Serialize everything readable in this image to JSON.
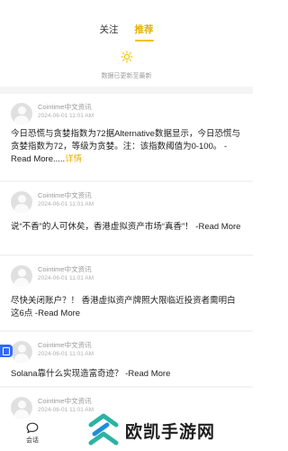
{
  "tabs": [
    {
      "label": "关注",
      "active": false
    },
    {
      "label": "推荐",
      "active": true
    }
  ],
  "refresh": {
    "icon": "sun-icon",
    "text": "数据已更新至最新"
  },
  "feed": [
    {
      "source": "Cointime中文资讯",
      "time": "2024-06-01 11:01 AM",
      "text": "今日恐慌与贪婪指数为72据Alternative数据显示，今日恐慌与贪婪指数为72，等级为贪婪。注：该指数阈值为0-100。 -Read More.....",
      "detail_link": "详情"
    },
    {
      "source": "Cointime中文资讯",
      "time": "2024-06-01 11:01 AM",
      "text": "说“不香”的人可休矣，香港虚拟资产市场“真香”！ -Read More"
    },
    {
      "source": "Cointime中文资讯",
      "time": "2024-06-01 11:01 AM",
      "text": "尽快关闭账户？！ 香港虚拟资产牌照大限临近投资者需明白这6点 -Read More"
    },
    {
      "source": "Cointime中文资讯",
      "time": "2024-06-01 11:01 AM",
      "text": "Solana靠什么实现造富奇迹？ -Read More"
    },
    {
      "source": "Cointime中文资讯",
      "time": "2024-06-01 11:01 AM",
      "text": ""
    }
  ],
  "bottom_nav": {
    "label": "会话",
    "icon": "chat-bubble-icon"
  },
  "watermark": {
    "text": "欧凯手游网"
  },
  "colors": {
    "accent": "#E8B100",
    "feed_bg": "#F4F4F4",
    "badge": "#2F6BFF"
  }
}
